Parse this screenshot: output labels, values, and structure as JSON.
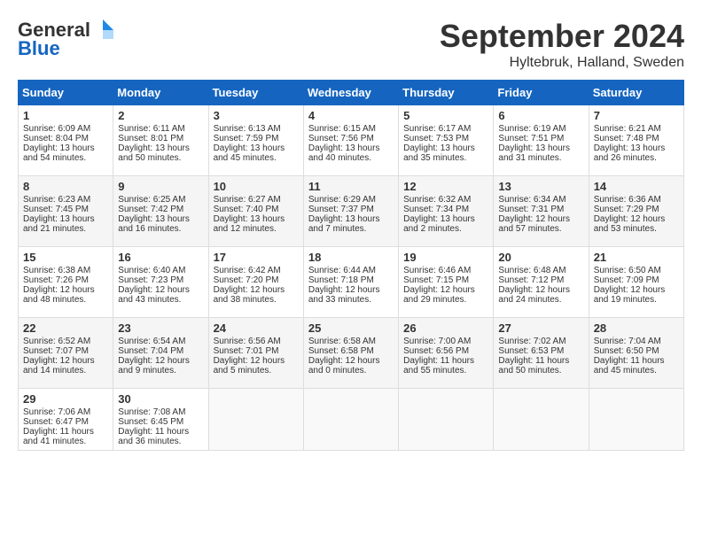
{
  "header": {
    "logo_general": "General",
    "logo_blue": "Blue",
    "month": "September 2024",
    "location": "Hyltebruk, Halland, Sweden"
  },
  "days_of_week": [
    "Sunday",
    "Monday",
    "Tuesday",
    "Wednesday",
    "Thursday",
    "Friday",
    "Saturday"
  ],
  "weeks": [
    [
      {
        "day": "1",
        "sunrise": "6:09 AM",
        "sunset": "8:04 PM",
        "daylight": "13 hours and 54 minutes."
      },
      {
        "day": "2",
        "sunrise": "6:11 AM",
        "sunset": "8:01 PM",
        "daylight": "13 hours and 50 minutes."
      },
      {
        "day": "3",
        "sunrise": "6:13 AM",
        "sunset": "7:59 PM",
        "daylight": "13 hours and 45 minutes."
      },
      {
        "day": "4",
        "sunrise": "6:15 AM",
        "sunset": "7:56 PM",
        "daylight": "13 hours and 40 minutes."
      },
      {
        "day": "5",
        "sunrise": "6:17 AM",
        "sunset": "7:53 PM",
        "daylight": "13 hours and 35 minutes."
      },
      {
        "day": "6",
        "sunrise": "6:19 AM",
        "sunset": "7:51 PM",
        "daylight": "13 hours and 31 minutes."
      },
      {
        "day": "7",
        "sunrise": "6:21 AM",
        "sunset": "7:48 PM",
        "daylight": "13 hours and 26 minutes."
      }
    ],
    [
      {
        "day": "8",
        "sunrise": "6:23 AM",
        "sunset": "7:45 PM",
        "daylight": "13 hours and 21 minutes."
      },
      {
        "day": "9",
        "sunrise": "6:25 AM",
        "sunset": "7:42 PM",
        "daylight": "13 hours and 16 minutes."
      },
      {
        "day": "10",
        "sunrise": "6:27 AM",
        "sunset": "7:40 PM",
        "daylight": "13 hours and 12 minutes."
      },
      {
        "day": "11",
        "sunrise": "6:29 AM",
        "sunset": "7:37 PM",
        "daylight": "13 hours and 7 minutes."
      },
      {
        "day": "12",
        "sunrise": "6:32 AM",
        "sunset": "7:34 PM",
        "daylight": "13 hours and 2 minutes."
      },
      {
        "day": "13",
        "sunrise": "6:34 AM",
        "sunset": "7:31 PM",
        "daylight": "12 hours and 57 minutes."
      },
      {
        "day": "14",
        "sunrise": "6:36 AM",
        "sunset": "7:29 PM",
        "daylight": "12 hours and 53 minutes."
      }
    ],
    [
      {
        "day": "15",
        "sunrise": "6:38 AM",
        "sunset": "7:26 PM",
        "daylight": "12 hours and 48 minutes."
      },
      {
        "day": "16",
        "sunrise": "6:40 AM",
        "sunset": "7:23 PM",
        "daylight": "12 hours and 43 minutes."
      },
      {
        "day": "17",
        "sunrise": "6:42 AM",
        "sunset": "7:20 PM",
        "daylight": "12 hours and 38 minutes."
      },
      {
        "day": "18",
        "sunrise": "6:44 AM",
        "sunset": "7:18 PM",
        "daylight": "12 hours and 33 minutes."
      },
      {
        "day": "19",
        "sunrise": "6:46 AM",
        "sunset": "7:15 PM",
        "daylight": "12 hours and 29 minutes."
      },
      {
        "day": "20",
        "sunrise": "6:48 AM",
        "sunset": "7:12 PM",
        "daylight": "12 hours and 24 minutes."
      },
      {
        "day": "21",
        "sunrise": "6:50 AM",
        "sunset": "7:09 PM",
        "daylight": "12 hours and 19 minutes."
      }
    ],
    [
      {
        "day": "22",
        "sunrise": "6:52 AM",
        "sunset": "7:07 PM",
        "daylight": "12 hours and 14 minutes."
      },
      {
        "day": "23",
        "sunrise": "6:54 AM",
        "sunset": "7:04 PM",
        "daylight": "12 hours and 9 minutes."
      },
      {
        "day": "24",
        "sunrise": "6:56 AM",
        "sunset": "7:01 PM",
        "daylight": "12 hours and 5 minutes."
      },
      {
        "day": "25",
        "sunrise": "6:58 AM",
        "sunset": "6:58 PM",
        "daylight": "12 hours and 0 minutes."
      },
      {
        "day": "26",
        "sunrise": "7:00 AM",
        "sunset": "6:56 PM",
        "daylight": "11 hours and 55 minutes."
      },
      {
        "day": "27",
        "sunrise": "7:02 AM",
        "sunset": "6:53 PM",
        "daylight": "11 hours and 50 minutes."
      },
      {
        "day": "28",
        "sunrise": "7:04 AM",
        "sunset": "6:50 PM",
        "daylight": "11 hours and 45 minutes."
      }
    ],
    [
      {
        "day": "29",
        "sunrise": "7:06 AM",
        "sunset": "6:47 PM",
        "daylight": "11 hours and 41 minutes."
      },
      {
        "day": "30",
        "sunrise": "7:08 AM",
        "sunset": "6:45 PM",
        "daylight": "11 hours and 36 minutes."
      },
      null,
      null,
      null,
      null,
      null
    ]
  ]
}
